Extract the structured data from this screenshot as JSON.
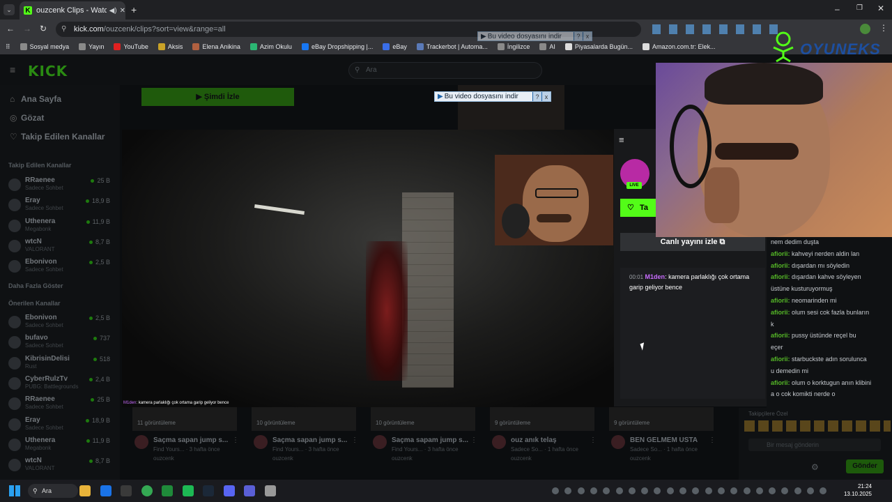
{
  "browser": {
    "tab_title": "ouzcenk Clips - Watch Live",
    "url_host": "kick.com",
    "url_path": "/ouzcenk/clips?sort=view&range=all",
    "bookmarks": [
      "Sosyal medya",
      "Yayın",
      "YouTube",
      "Aksis",
      "Elena Anikina",
      "Azim Okulu",
      "eBay Dropshipping |...",
      "eBay",
      "Trackerbot | Automa...",
      "İngilizce",
      "AI",
      "Piyasalarda Bugün...",
      "Amazon.com.tr: Elek..."
    ],
    "bookmark_colors": [
      "#8a8a8a",
      "#8a8a8a",
      "#e02020",
      "#c9a227",
      "#b06040",
      "#2bb673",
      "#1877f2",
      "#3a6ee8",
      "#5a7ab8",
      "#8a8a8a",
      "#8a8a8a",
      "#dddddd",
      "#dddddd"
    ],
    "download_popup": "Bu video dosyasını indir",
    "download_popup_q": "?",
    "download_popup_x": "x"
  },
  "kick": {
    "logo": "KICK",
    "search_placeholder": "Ara",
    "nav": [
      {
        "icon": "⌂",
        "label": "Ana Sayfa"
      },
      {
        "icon": "◎",
        "label": "Gözat"
      },
      {
        "icon": "♡",
        "label": "Takip Edilen Kanallar"
      }
    ],
    "followed_title": "Takip Edilen Kanallar",
    "followed": [
      {
        "name": "RRaenee",
        "game": "Sadece Sohbet",
        "viewers": "25 B"
      },
      {
        "name": "Eray",
        "game": "Sadece Sohbet",
        "viewers": "18,9 B"
      },
      {
        "name": "Uthenera",
        "game": "Megabonk",
        "viewers": "11,9 B"
      },
      {
        "name": "wtcN",
        "game": "VALORANT",
        "viewers": "8,7 B"
      },
      {
        "name": "Ebonivon",
        "game": "Sadece Sohbet",
        "viewers": "2,5 B"
      }
    ],
    "show_more": "Daha Fazla Göster",
    "recommended_title": "Önerilen Kanallar",
    "recommended": [
      {
        "name": "Ebonivon",
        "game": "Sadece Sohbet",
        "viewers": "2,5 B"
      },
      {
        "name": "bufavo",
        "game": "Sadece Sohbet",
        "viewers": "737"
      },
      {
        "name": "KibrisinDelisi",
        "game": "Rust",
        "viewers": "518"
      },
      {
        "name": "CyberRulzTv",
        "game": "PUBG: Battlegrounds",
        "viewers": "2,4 B"
      },
      {
        "name": "RRaenee",
        "game": "Sadece Sohbet",
        "viewers": "25 B"
      },
      {
        "name": "Eray",
        "game": "Sadece Sohbet",
        "viewers": "18,9 B"
      },
      {
        "name": "Uthenera",
        "game": "Megabonk",
        "viewers": "11,9 B"
      },
      {
        "name": "wtcN",
        "game": "VALORANT",
        "viewers": "8,7 B"
      }
    ],
    "watch_now": "▶ Şimdi İzle",
    "video_chat_user": "M1den",
    "video_chat_text": ": kamera parlaklığı çok ortama garip geliyor bence",
    "live_tag": "LIVE",
    "follow_label": "Ta",
    "live_watch": "Canlı yayını izle ⧉",
    "chat": {
      "time": "00:01",
      "user": "M1den",
      "text": ": kamera parlaklığı çok ortama garip geliyor bence"
    },
    "clips": [
      {
        "views": "11 görüntüleme",
        "title": "Saçma sapan jump s...",
        "meta": "Find Yours... · 3 hafta önce",
        "user": "ouzcenk"
      },
      {
        "views": "10 görüntüleme",
        "title": "Saçma sapan jump s...",
        "meta": "Find Yours... · 3 hafta önce",
        "user": "ouzcenk"
      },
      {
        "views": "10 görüntüleme",
        "title": "Saçma sapam jump s...",
        "meta": "Find Yours... · 3 hafta önce",
        "user": "ouzcenk"
      },
      {
        "views": "9 görüntüleme",
        "title": "ouz anık telaş",
        "meta": "Sadece So... · 1 hafta önce",
        "user": "ouzcenk"
      },
      {
        "views": "9 görüntüleme",
        "title": "BEN GELMEM USTA",
        "meta": "Sadece So... · 1 hafta önce",
        "user": "ouzcenk"
      }
    ]
  },
  "stream_overlay": {
    "brand": "OYUNEKS",
    "side_chat": [
      {
        "user": "",
        "text": "nem dedim duşta"
      },
      {
        "user": "afiorii:",
        "text": " kahveyi nerden aldin lan"
      },
      {
        "user": "afiorii:",
        "text": " dışardan mı söyledin"
      },
      {
        "user": "afiorii:",
        "text": " dışardan kahve söyleyen"
      },
      {
        "user": "",
        "text": " üstüne kusturuyormuş"
      },
      {
        "user": "afiorii:",
        "text": " neomarinden mi"
      },
      {
        "user": "afiorii:",
        "text": " olum sesi cok fazla bunların"
      },
      {
        "user": "",
        "text": "k"
      },
      {
        "user": "afiorii:",
        "text": " pussy üstünde reçel bu"
      },
      {
        "user": "",
        "text": "eçer"
      },
      {
        "user": "afiorii:",
        "text": " starbuckste adın sorulunca"
      },
      {
        "user": "",
        "text": "u demedin mi"
      },
      {
        "user": "afiorii:",
        "text": " olum o korktugun anın klibini"
      },
      {
        "user": "",
        "text": "a o cok komikti nerde o"
      }
    ],
    "supporters": "Takipçilere Özel",
    "message_placeholder": "Bir mesaj gönderin",
    "send": "Gönder"
  },
  "taskbar": {
    "search": "Ara",
    "time": "21:24",
    "date": "13.10.2025"
  }
}
